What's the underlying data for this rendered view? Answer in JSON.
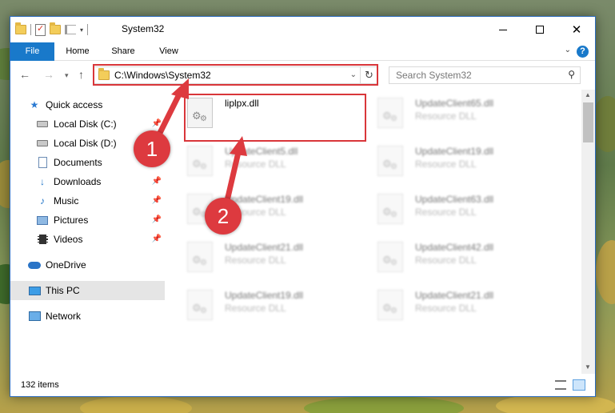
{
  "window": {
    "title": "System32",
    "controls": {
      "minimize": "minimize",
      "maximize": "maximize",
      "close": "✕"
    }
  },
  "ribbon": {
    "tabs": [
      "File",
      "Home",
      "Share",
      "View"
    ],
    "help": "?"
  },
  "address_bar": {
    "path": "C:\\Windows\\System32",
    "search_placeholder": "Search System32"
  },
  "sidebar": {
    "items": [
      {
        "label": "Quick access",
        "icon": "star-icon",
        "pinned": false
      },
      {
        "label": "Local Disk (C:)",
        "icon": "drive-icon",
        "pinned": true
      },
      {
        "label": "Local Disk (D:)",
        "icon": "drive-icon",
        "pinned": false
      },
      {
        "label": "Documents",
        "icon": "documents-icon",
        "pinned": true
      },
      {
        "label": "Downloads",
        "icon": "download-icon",
        "pinned": true
      },
      {
        "label": "Music",
        "icon": "music-icon",
        "pinned": true
      },
      {
        "label": "Pictures",
        "icon": "pictures-icon",
        "pinned": true
      },
      {
        "label": "Videos",
        "icon": "videos-icon",
        "pinned": true
      },
      {
        "label": "OneDrive",
        "icon": "onedrive-icon",
        "pinned": false
      },
      {
        "label": "This PC",
        "icon": "this-pc-icon",
        "pinned": false,
        "selected": true
      },
      {
        "label": "Network",
        "icon": "network-icon",
        "pinned": false
      }
    ]
  },
  "files": [
    {
      "name": "liplpx.dll",
      "type": "",
      "highlighted": true
    },
    {
      "name": "UpdateClient65.dll",
      "type": "Resource DLL"
    },
    {
      "name": "UpdateClient5.dll",
      "type": "Resource DLL"
    },
    {
      "name": "UpdateClient19.dll",
      "type": "Resource DLL"
    },
    {
      "name": "UpdateClient19.dll",
      "type": "Resource DLL"
    },
    {
      "name": "UpdateClient63.dll",
      "type": "Resource DLL"
    },
    {
      "name": "UpdateClient21.dll",
      "type": "Resource DLL"
    },
    {
      "name": "UpdateClient42.dll",
      "type": "Resource DLL"
    },
    {
      "name": "UpdateClient19.dll",
      "type": "Resource DLL"
    },
    {
      "name": "UpdateClient21.dll",
      "type": "Resource DLL"
    }
  ],
  "status": {
    "item_count": "132 items"
  },
  "callouts": {
    "step1": "1",
    "step2": "2"
  },
  "colors": {
    "accent": "#1979ca",
    "annotation": "#d9363a",
    "selected_bg": "#e5e5e5"
  }
}
